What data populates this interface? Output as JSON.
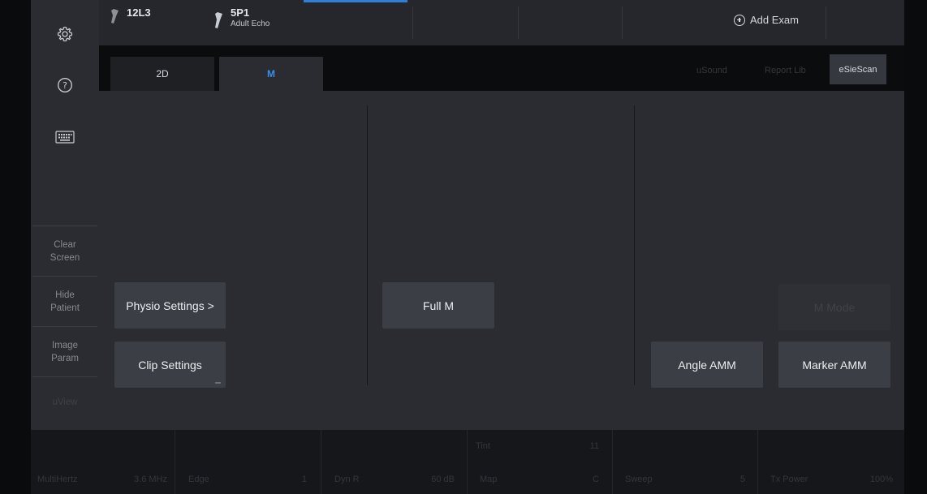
{
  "sidebar": {
    "icons": [
      {
        "name": "settings",
        "icon": "gear-icon"
      },
      {
        "name": "help",
        "icon": "question-circle-icon"
      },
      {
        "name": "keyboard",
        "icon": "keyboard-icon"
      }
    ],
    "buttons": [
      {
        "label": "Clear\nScreen"
      },
      {
        "label": "Hide\nPatient"
      },
      {
        "label": "Image\nParam"
      },
      {
        "label": "uView"
      }
    ]
  },
  "topbar": {
    "probes": [
      {
        "name": "12L3",
        "subtitle": "",
        "icon": "probe-icon",
        "active": false
      },
      {
        "name": "5P1",
        "subtitle": "Adult Echo",
        "icon": "probe-icon",
        "active": true
      }
    ],
    "add_exam_label": "Add Exam",
    "accent_color": "#2f7fd6"
  },
  "tabs": {
    "items": [
      {
        "label": "2D",
        "active": false
      },
      {
        "label": "M",
        "active": true
      }
    ],
    "right_options": [
      "uSound",
      "Report Lib"
    ],
    "esiescan_label": "eSieScan"
  },
  "main": {
    "physio_settings_label": "Physio Settings >",
    "clip_settings_label": "Clip Settings",
    "full_m_label": "Full M",
    "m_mode_label": "M Mode",
    "angle_amm_label": "Angle AMM",
    "marker_amm_label": "Marker AMM"
  },
  "bottom": {
    "params": [
      {
        "name": "MultiHertz",
        "value": "3.6 MHz"
      },
      {
        "name": "Edge",
        "value": "1"
      },
      {
        "name": "Dyn R",
        "value": "60 dB"
      },
      {
        "name": "Map",
        "value": "C"
      },
      {
        "name": "Sweep",
        "value": "5"
      },
      {
        "name": "Tx Power",
        "value": "100%"
      }
    ],
    "upper_param": {
      "name": "Tint",
      "value": "11"
    }
  }
}
